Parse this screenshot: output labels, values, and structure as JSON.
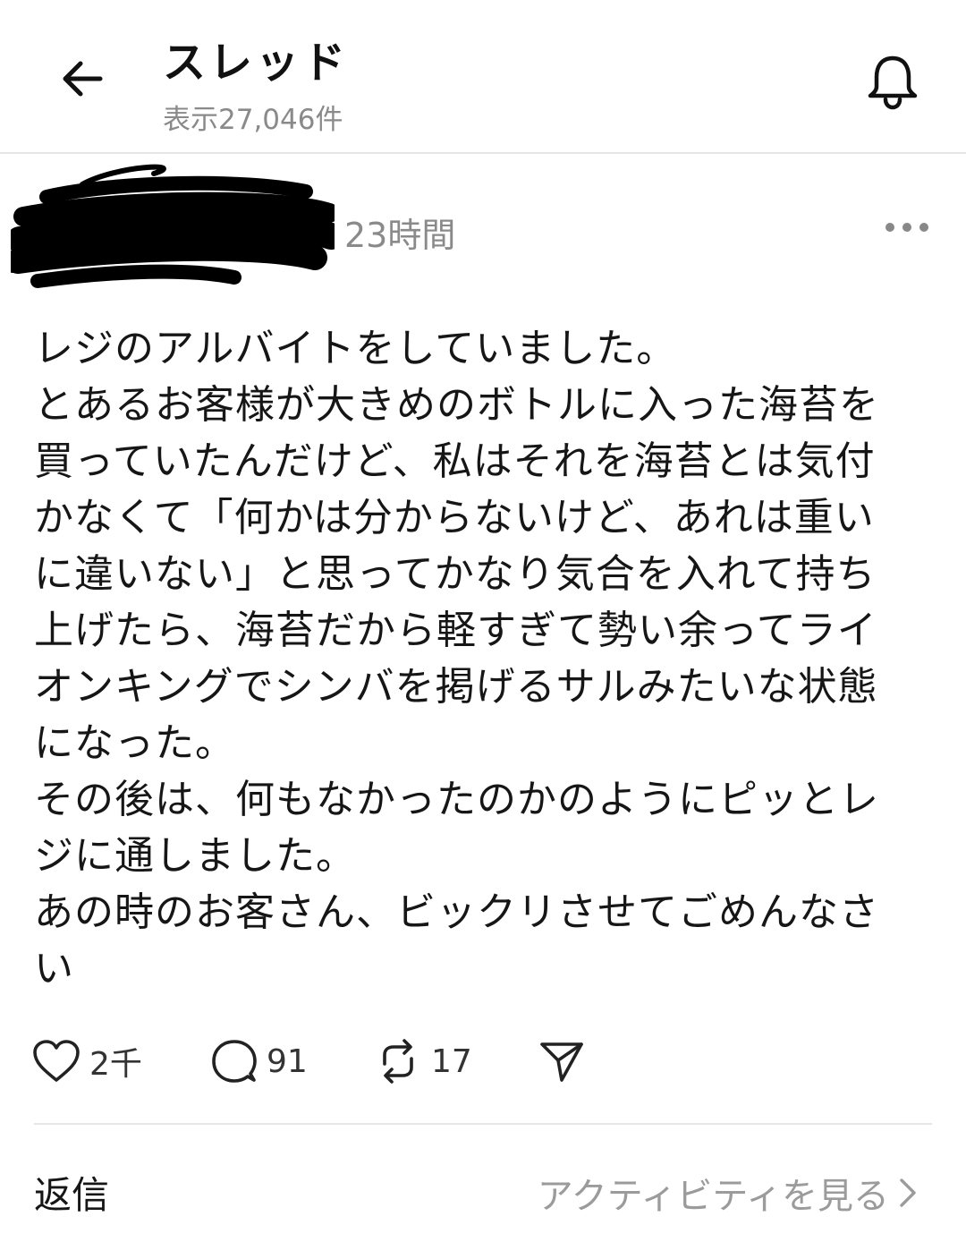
{
  "header": {
    "title": "スレッド",
    "views": "表示27,046件"
  },
  "post": {
    "time": "23時間",
    "lines": [
      "レジのアルバイトをしていました。",
      "とあるお客様が大きめのボトルに入った海苔を",
      "買っていたんだけど、私はそれを海苔とは気付",
      "かなくて「何かは分からないけど、あれは重い",
      "に違いない」と思ってかなり気合を入れて持ち",
      "上げたら、海苔だから軽すぎて勢い余ってライ",
      "オンキングでシンバを掲げるサルみたいな状態",
      "になった。",
      "その後は、何もなかったのかのようにピッとレ",
      "ジに通しました。",
      "あの時のお客さん、ビックリさせてごめんなさ",
      "い"
    ]
  },
  "actions": {
    "likes": "2千",
    "replies": "91",
    "reposts": "17"
  },
  "footer": {
    "replies_label": "返信",
    "activity_label": "アクティビティを見る"
  },
  "icons": {
    "back": "arrow-left-icon",
    "bell": "bell-icon",
    "more": "more-horizontal-icon",
    "like": "heart-icon",
    "reply": "comment-bubble-icon",
    "repost": "repost-icon",
    "share": "send-icon",
    "chevron": "chevron-right-icon"
  }
}
